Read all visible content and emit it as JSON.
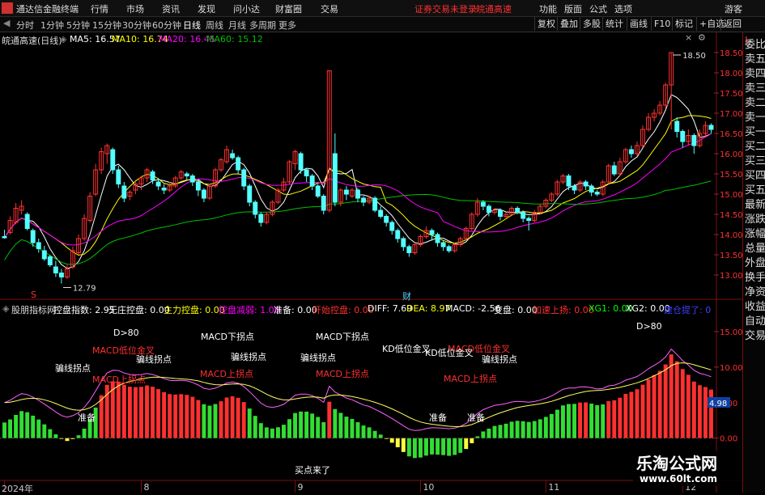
{
  "topbar": {
    "app_title": "通达信金融终端",
    "menus": [
      "行情",
      "市场",
      "资讯",
      "发现",
      "问小达",
      "财富圈",
      "交易"
    ],
    "warning": "证券交易未登录",
    "stock_short": "皖通高速",
    "right_menus": [
      "功能",
      "版面",
      "公式",
      "选项"
    ],
    "guest": "游客"
  },
  "tabs": [
    "分时",
    "1分钟",
    "5分钟",
    "15分钟",
    "30分钟",
    "60分钟",
    "日线",
    "周线",
    "月线",
    "多周期",
    "更多"
  ],
  "active_tab": "日线",
  "right_buttons": [
    "复权",
    "叠加",
    "多股",
    "统计",
    "画线",
    "F10",
    "标记",
    "+自选",
    "返回"
  ],
  "ma_bar": {
    "title": "皖通高速(日线)",
    "ma5": "MA5: 16.57",
    "ma10": "MA10: 16.74",
    "ma20": "MA20: 16.45",
    "ma60": "MA60: 15.12"
  },
  "sidebar": [
    "委比",
    "卖五",
    "卖四",
    "卖三",
    "卖二",
    "卖一",
    "买一",
    "买二",
    "买三",
    "买四",
    "买五",
    "最新",
    "涨跌",
    "涨幅",
    "总量",
    "外盘",
    "换手",
    "净资",
    "收益",
    "自动",
    "交易"
  ],
  "sidebar_corner": "L",
  "indicator_bar": {
    "name": "股朋指标网",
    "items": [
      {
        "text": "控盘指数: 2.95",
        "color": "#ffffff"
      },
      {
        "text": "无庄控盘: 0.00",
        "color": "#ffffff"
      },
      {
        "text": "主力控盘: 0.00",
        "color": "#ffff00"
      },
      {
        "text": "控盘减弱: 1.00",
        "color": "#ff00ff"
      },
      {
        "text": "准备: 0.00",
        "color": "#ffffff"
      },
      {
        "text": "开始控盘: 0.00",
        "color": "#ff3030"
      },
      {
        "text": "DIFF: 7.69",
        "color": "#ffffff"
      },
      {
        "text": "DEA: 8.97",
        "color": "#ffff00"
      },
      {
        "text": "MACD: -2.56",
        "color": "#ffffff"
      },
      {
        "text": "变盘: 0.00",
        "color": "#ffffff"
      },
      {
        "text": "加速上扬: 0.00",
        "color": "#ff3030"
      },
      {
        "text": "XG1: 0.00",
        "color": "#00ff00"
      },
      {
        "text": "XG2: 0.00",
        "color": "#ffffff"
      },
      {
        "text": "建仓提了: 0",
        "color": "#4040ff"
      }
    ]
  },
  "annotations": {
    "d80": "D>80",
    "macd_low_cross": "MACD低位金叉",
    "macd_down_turn": "MACD下拐点",
    "macd_up_turn": "MACD上拐点",
    "kd_low_cross": "KD低位金叉",
    "line_turn": "骗线拐点",
    "ready": "准备",
    "buy_point": "买点来了",
    "cai": "财",
    "s": "S"
  },
  "chart_data": [
    {
      "type": "candlestick",
      "title": "皖通高速(日线)",
      "ylim": [
        12.7,
        18.8
      ],
      "y_ticks": [
        13.0,
        13.5,
        14.0,
        14.5,
        15.0,
        15.5,
        16.0,
        16.5,
        17.0,
        17.5,
        18.0,
        18.5
      ],
      "high_label": "18.50",
      "low_label": "12.79",
      "x_labels": [
        "2024年",
        "8",
        "9",
        "10",
        "11",
        "12"
      ],
      "x_label_index": [
        0,
        24,
        51,
        73,
        95,
        119
      ],
      "candles": [
        [
          13.95,
          13.92,
          14.12,
          13.9
        ],
        [
          14.05,
          14.35,
          14.45,
          14.0
        ],
        [
          14.3,
          14.65,
          14.78,
          14.25
        ],
        [
          14.6,
          14.7,
          14.85,
          14.5
        ],
        [
          14.5,
          14.15,
          14.55,
          14.1
        ],
        [
          14.1,
          13.8,
          14.15,
          13.7
        ],
        [
          13.8,
          13.65,
          13.9,
          13.55
        ],
        [
          13.6,
          13.4,
          13.72,
          13.35
        ],
        [
          13.45,
          13.25,
          13.5,
          13.2
        ],
        [
          13.2,
          13.05,
          13.35,
          12.95
        ],
        [
          13.05,
          12.95,
          13.15,
          12.79
        ],
        [
          12.95,
          13.15,
          13.25,
          12.9
        ],
        [
          13.2,
          13.6,
          13.7,
          13.15
        ],
        [
          13.55,
          13.9,
          14.0,
          13.5
        ],
        [
          13.9,
          14.4,
          14.5,
          13.85
        ],
        [
          14.35,
          14.95,
          15.05,
          14.3
        ],
        [
          15.0,
          15.6,
          15.75,
          14.95
        ],
        [
          15.6,
          16.05,
          16.15,
          15.5
        ],
        [
          16.0,
          16.2,
          16.25,
          15.75
        ],
        [
          16.1,
          15.6,
          16.15,
          15.5
        ],
        [
          15.6,
          15.25,
          15.7,
          15.15
        ],
        [
          15.2,
          14.9,
          15.3,
          14.8
        ],
        [
          14.95,
          15.05,
          15.1,
          14.85
        ],
        [
          15.1,
          15.25,
          15.3,
          15.0
        ],
        [
          15.25,
          15.4,
          15.45,
          15.1
        ],
        [
          15.4,
          15.6,
          15.65,
          15.3
        ],
        [
          15.55,
          15.35,
          15.6,
          15.25
        ],
        [
          15.3,
          15.2,
          15.4,
          15.1
        ],
        [
          15.15,
          15.1,
          15.25,
          15.0
        ],
        [
          15.1,
          15.2,
          15.3,
          15.05
        ],
        [
          15.2,
          15.4,
          15.45,
          15.15
        ],
        [
          15.4,
          15.55,
          15.6,
          15.35
        ],
        [
          15.5,
          15.45,
          15.55,
          15.35
        ],
        [
          15.45,
          15.3,
          15.5,
          15.2
        ],
        [
          15.3,
          15.1,
          15.35,
          14.95
        ],
        [
          15.1,
          14.9,
          15.15,
          14.8
        ],
        [
          14.9,
          15.2,
          15.25,
          14.85
        ],
        [
          15.2,
          15.6,
          15.65,
          15.15
        ],
        [
          15.6,
          15.85,
          15.9,
          15.55
        ],
        [
          15.8,
          16.1,
          16.2,
          15.75
        ],
        [
          16.0,
          15.9,
          16.1,
          15.85
        ],
        [
          15.9,
          15.6,
          15.95,
          15.5
        ],
        [
          15.6,
          15.2,
          15.65,
          15.1
        ],
        [
          15.2,
          14.8,
          15.25,
          14.7
        ],
        [
          14.8,
          14.5,
          14.85,
          14.4
        ],
        [
          14.5,
          14.3,
          14.55,
          14.2
        ],
        [
          14.3,
          14.5,
          14.55,
          14.25
        ],
        [
          14.5,
          14.8,
          14.85,
          14.45
        ],
        [
          14.8,
          15.1,
          15.15,
          14.75
        ],
        [
          15.1,
          15.3,
          15.4,
          15.05
        ],
        [
          15.3,
          15.8,
          15.85,
          15.25
        ],
        [
          15.75,
          16.05,
          16.1,
          15.6
        ],
        [
          16.0,
          15.6,
          16.05,
          15.5
        ],
        [
          15.6,
          15.45,
          15.65,
          15.3
        ],
        [
          15.45,
          15.2,
          15.5,
          15.1
        ],
        [
          15.2,
          14.95,
          15.25,
          14.9
        ],
        [
          14.95,
          14.6,
          15.0,
          14.5
        ],
        [
          14.6,
          18.05,
          18.05,
          14.55
        ],
        [
          16.0,
          14.8,
          16.5,
          14.7
        ],
        [
          14.8,
          15.1,
          15.15,
          14.7
        ],
        [
          15.1,
          15.0,
          15.2,
          14.85
        ],
        [
          14.95,
          15.1,
          15.15,
          14.9
        ],
        [
          15.1,
          14.9,
          15.15,
          14.8
        ],
        [
          14.9,
          14.8,
          14.95,
          14.7
        ],
        [
          14.8,
          14.9,
          14.95,
          14.75
        ],
        [
          14.9,
          14.6,
          14.95,
          14.55
        ],
        [
          14.6,
          14.45,
          14.7,
          14.4
        ],
        [
          14.45,
          14.3,
          14.5,
          14.2
        ],
        [
          14.3,
          14.1,
          14.35,
          14.0
        ],
        [
          14.1,
          13.9,
          14.15,
          13.8
        ],
        [
          13.9,
          13.7,
          13.95,
          13.6
        ],
        [
          13.7,
          13.55,
          13.75,
          13.45
        ],
        [
          13.55,
          13.75,
          13.8,
          13.5
        ],
        [
          13.75,
          13.95,
          14.0,
          13.7
        ],
        [
          13.95,
          14.1,
          14.2,
          13.9
        ],
        [
          14.1,
          14.0,
          14.15,
          13.85
        ],
        [
          14.0,
          13.8,
          14.05,
          13.7
        ],
        [
          13.8,
          13.7,
          13.85,
          13.6
        ],
        [
          13.7,
          13.6,
          13.75,
          13.55
        ],
        [
          13.6,
          13.75,
          13.8,
          13.55
        ],
        [
          13.75,
          13.9,
          13.95,
          13.7
        ],
        [
          13.9,
          14.15,
          14.2,
          13.85
        ],
        [
          14.15,
          14.5,
          14.55,
          14.1
        ],
        [
          14.5,
          14.8,
          14.9,
          14.45
        ],
        [
          14.8,
          14.7,
          14.85,
          14.6
        ],
        [
          14.7,
          14.55,
          14.75,
          14.45
        ],
        [
          14.55,
          14.6,
          14.65,
          14.5
        ],
        [
          14.6,
          14.45,
          14.65,
          14.35
        ],
        [
          14.45,
          14.5,
          14.55,
          14.4
        ],
        [
          14.5,
          14.65,
          14.7,
          14.45
        ],
        [
          14.65,
          14.55,
          14.7,
          14.5
        ],
        [
          14.55,
          14.4,
          14.6,
          14.3
        ],
        [
          14.4,
          14.35,
          14.45,
          14.1
        ],
        [
          14.35,
          14.55,
          14.6,
          14.3
        ],
        [
          14.55,
          14.7,
          14.75,
          14.5
        ],
        [
          14.7,
          14.85,
          14.9,
          14.65
        ],
        [
          14.85,
          15.0,
          15.05,
          14.8
        ],
        [
          15.0,
          15.3,
          15.35,
          14.95
        ],
        [
          15.3,
          15.45,
          15.5,
          15.25
        ],
        [
          15.45,
          15.2,
          15.5,
          15.1
        ],
        [
          15.2,
          15.1,
          15.25,
          15.0
        ],
        [
          15.1,
          15.3,
          15.35,
          15.05
        ],
        [
          15.3,
          15.2,
          15.35,
          15.1
        ],
        [
          15.2,
          15.05,
          15.25,
          14.95
        ],
        [
          15.05,
          15.0,
          15.1,
          14.95
        ],
        [
          15.0,
          15.3,
          15.35,
          14.95
        ],
        [
          15.3,
          15.7,
          15.75,
          15.25
        ],
        [
          15.7,
          15.5,
          15.8,
          15.45
        ],
        [
          15.5,
          15.8,
          15.9,
          15.45
        ],
        [
          15.8,
          16.1,
          16.15,
          15.75
        ],
        [
          16.1,
          16.0,
          16.2,
          15.9
        ],
        [
          16.0,
          16.2,
          16.3,
          15.95
        ],
        [
          16.2,
          16.6,
          16.7,
          16.15
        ],
        [
          16.6,
          16.9,
          17.0,
          16.55
        ],
        [
          16.9,
          17.0,
          17.1,
          16.8
        ],
        [
          17.0,
          17.2,
          17.3,
          16.95
        ],
        [
          17.2,
          17.7,
          17.75,
          17.1
        ],
        [
          17.7,
          18.5,
          18.5,
          16.6
        ],
        [
          16.8,
          16.55,
          16.9,
          16.4
        ],
        [
          16.55,
          16.3,
          16.6,
          16.15
        ],
        [
          16.3,
          16.45,
          16.6,
          16.2
        ],
        [
          16.45,
          16.2,
          16.5,
          16.0
        ],
        [
          16.2,
          16.5,
          16.6,
          16.15
        ],
        [
          16.5,
          16.7,
          16.8,
          16.4
        ],
        [
          16.7,
          16.6,
          16.75,
          16.5
        ]
      ],
      "series_lines": [
        {
          "name": "MA5",
          "color": "#ffffff"
        },
        {
          "name": "MA10",
          "color": "#ffff00"
        },
        {
          "name": "MA20",
          "color": "#ff00ff"
        },
        {
          "name": "MA60",
          "color": "#00c000"
        }
      ]
    },
    {
      "type": "bar",
      "title": "股朋指标网",
      "ylim": [
        -5.5,
        17.5
      ],
      "y_ticks": [
        0.0,
        5.0,
        10.0,
        15.0
      ],
      "current_value_label": "4.98",
      "bars_per_candle": true
    }
  ]
}
